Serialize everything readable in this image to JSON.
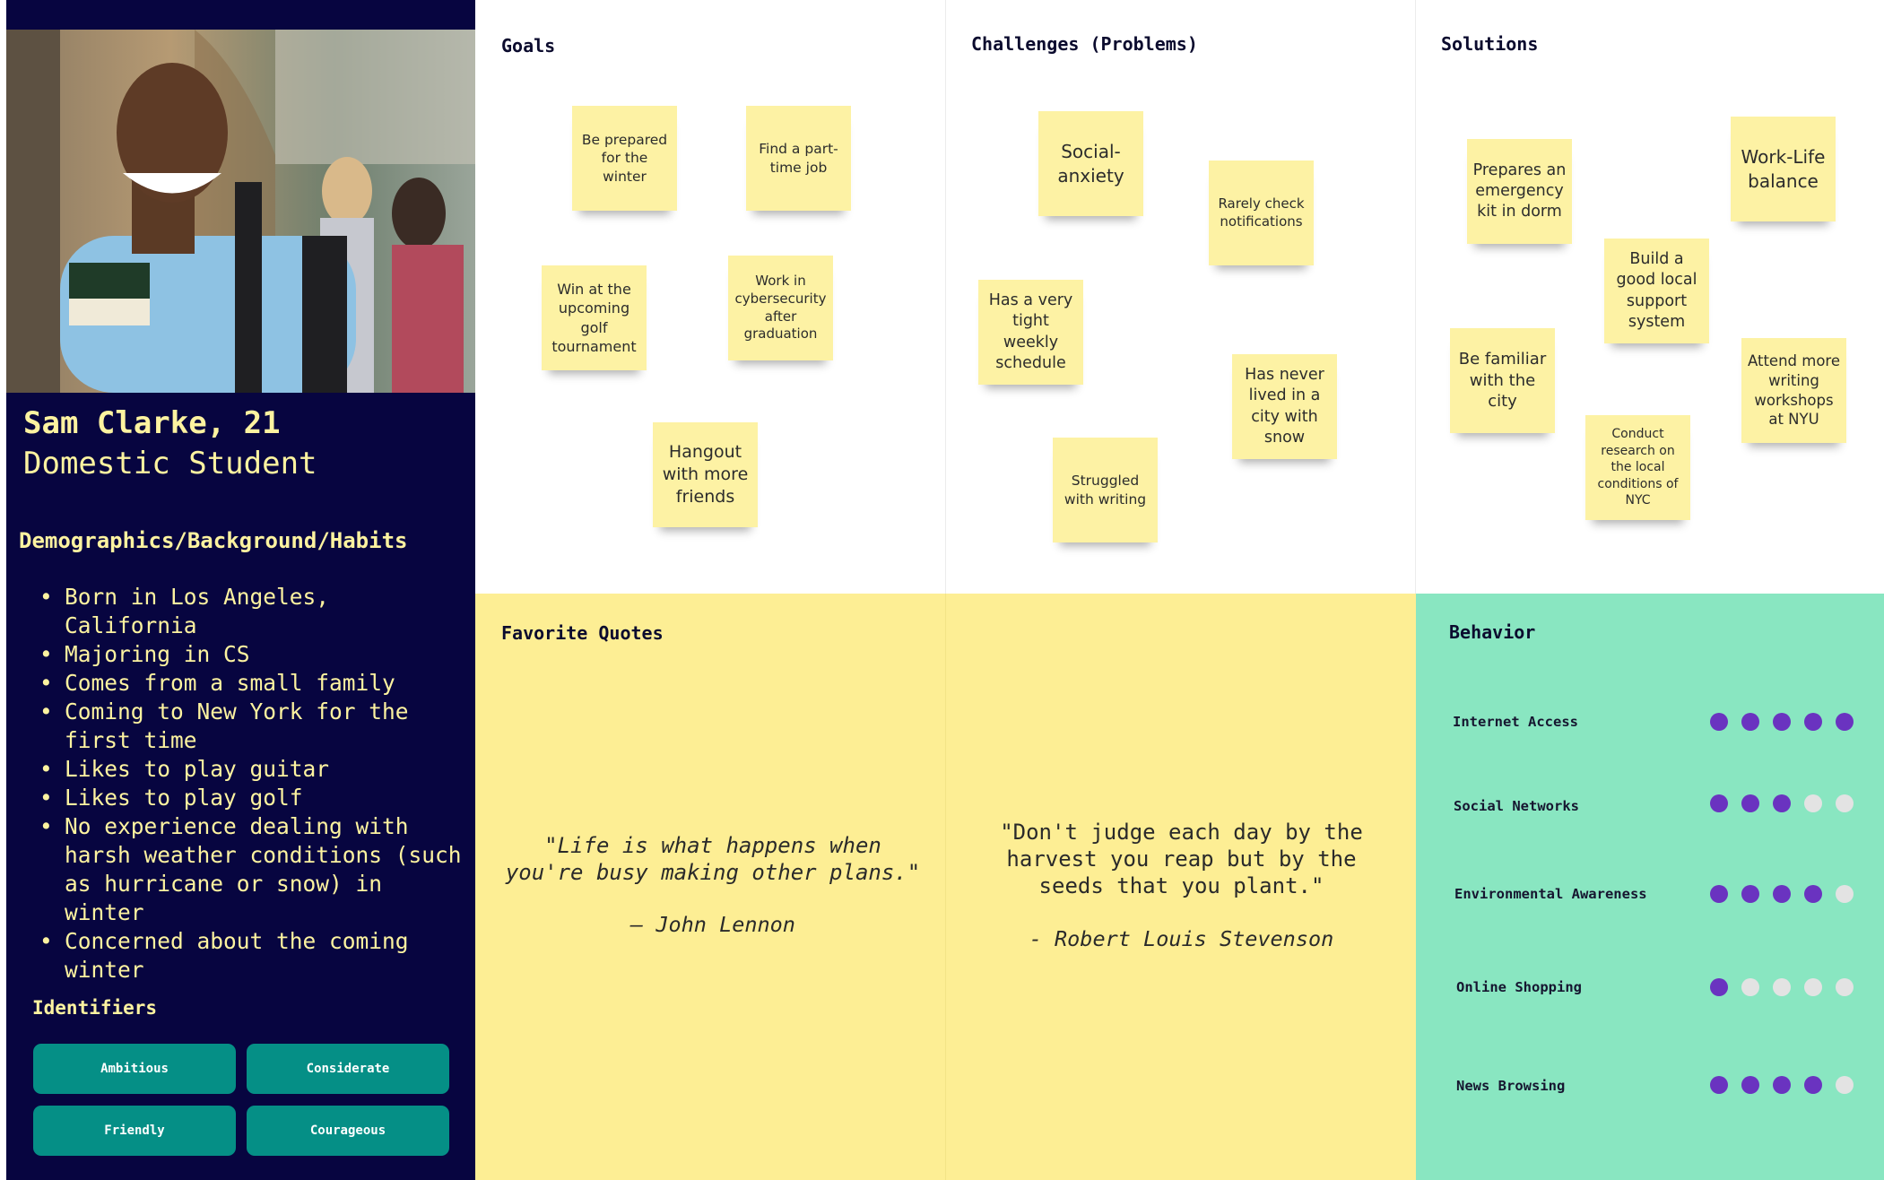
{
  "persona": {
    "name": "Sam Clarke, 21",
    "role": "Domestic Student",
    "demographics_title": "Demographics/Background/Habits",
    "demographics": [
      "Born in Los Angeles, California",
      "Majoring in CS",
      "Comes from a small family",
      "Coming to New York for the first time",
      "Likes to play guitar",
      "Likes to play golf",
      "No experience dealing with harsh weather conditions (such as hurricane or snow) in winter",
      "Concerned about the coming winter"
    ],
    "identifiers_title": "Identifiers",
    "identifiers": [
      "Ambitious",
      "Considerate",
      "Friendly",
      "Courageous"
    ]
  },
  "goals": {
    "title": "Goals",
    "notes": [
      "Be prepared for the winter",
      "Find a part-time job",
      "Win at the upcoming golf tournament",
      "Work in cybersecurity after graduation",
      "Hangout with more friends"
    ]
  },
  "challenges": {
    "title": "Challenges (Problems)",
    "notes": [
      "Social-anxiety",
      "Rarely check notifications",
      "Has a very tight weekly schedule",
      "Has never lived in a city with snow",
      "Struggled with writing"
    ]
  },
  "solutions": {
    "title": "Solutions",
    "notes": [
      "Prepares an emergency kit in dorm",
      "Work-Life balance",
      "Build a good local support system",
      "Be familiar with the city",
      "Attend more writing workshops at NYU",
      "Conduct research on the local conditions of NYC"
    ]
  },
  "quotes": {
    "title": "Favorite Quotes",
    "items": [
      {
        "text": "\"Life is what happens when you're busy making other plans.\"",
        "author": "— John Lennon"
      },
      {
        "text": "\"Don't judge each day by the harvest you reap but by the seeds that you plant.\"",
        "author": "- Robert Louis Stevenson"
      }
    ]
  },
  "behavior": {
    "title": "Behavior",
    "scale_max": 5,
    "colors": {
      "on": "#6a33c0",
      "off": "#e3e3e3"
    },
    "items": [
      {
        "label": "Internet Access",
        "level": 5
      },
      {
        "label": "Social Networks",
        "level": 3
      },
      {
        "label": "Environmental Awareness",
        "level": 4
      },
      {
        "label": "Online Shopping",
        "level": 1
      },
      {
        "label": "News Browsing",
        "level": 4
      }
    ]
  }
}
